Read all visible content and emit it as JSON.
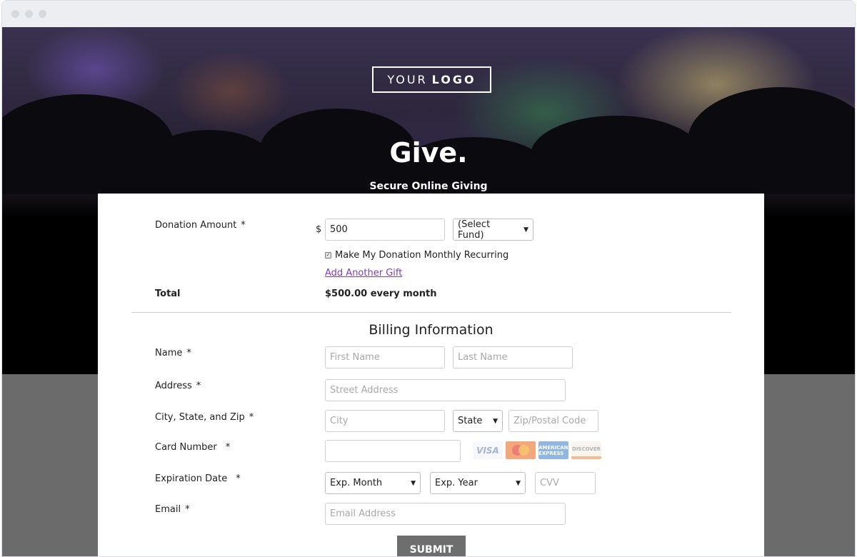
{
  "logo": {
    "text_light": "YOUR",
    "text_bold": "LOGO"
  },
  "hero": {
    "title": "Give.",
    "subtitle": "Secure Online Giving"
  },
  "donation": {
    "label": "Donation Amount",
    "required": "*",
    "currency": "$",
    "amount_value": "500",
    "fund_select": "(Select Fund)",
    "recurring_label": "Make My Donation Monthly Recurring",
    "recurring_checked": true,
    "add_gift_link": "Add Another Gift",
    "total_label": "Total",
    "total_value": "$500.00 every month"
  },
  "billing": {
    "title": "Billing Information",
    "name_label": "Name",
    "first_name_placeholder": "First Name",
    "last_name_placeholder": "Last Name",
    "address_label": "Address",
    "street_placeholder": "Street Address",
    "city_label": "City, State, and Zip",
    "city_placeholder": "City",
    "state_select": "State",
    "zip_placeholder": "Zip/Postal Code",
    "card_label": "Card Number",
    "card_brands": [
      "VISA",
      "MasterCard",
      "AMERICAN EXPRESS",
      "DISCOVER"
    ],
    "exp_label": "Expiration Date",
    "exp_month_select": "Exp. Month",
    "exp_year_select": "Exp. Year",
    "cvv_placeholder": "CVV",
    "email_label": "Email",
    "email_placeholder": "Email Address",
    "required": "*"
  },
  "submit_label": "SUBMIT",
  "colors": {
    "link": "#7a3fb5",
    "submit_bg": "#6e6e6e",
    "hero_bottom": "#000000",
    "page_band": "#6b6b6b"
  }
}
